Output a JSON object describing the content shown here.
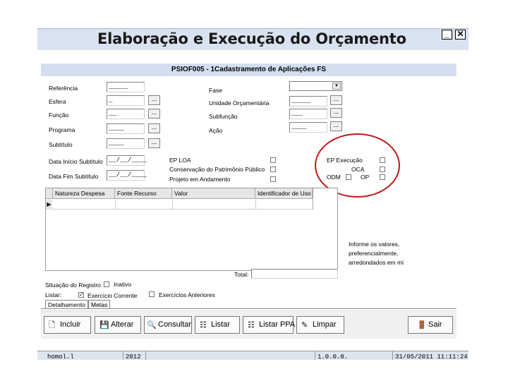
{
  "window": {
    "title": "Elaboração e Execução do Orçamento",
    "minimize_label": "_",
    "close_label": "✕"
  },
  "form": {
    "header": "PSIOF005 - 1Cadastramento de Aplicações FS",
    "left": {
      "referencia": {
        "label": "Referência",
        "value": "_____"
      },
      "esfera": {
        "label": "Esfera",
        "value": "_",
        "button": "..."
      },
      "funcao": {
        "label": "Função",
        "value": "__",
        "button": "..."
      },
      "programa": {
        "label": "Programa",
        "value": "____",
        "button": "..."
      },
      "subtitulo": {
        "label": "Subtítulo",
        "value": "____",
        "button": "..."
      },
      "data_inicio": {
        "label": "Data Início Subtítulo",
        "value": "__/__/____"
      },
      "data_fim": {
        "label": "Data Fim Subtítulo",
        "value": "__/__/____"
      }
    },
    "right": {
      "fase": {
        "label": "Fase",
        "value": ""
      },
      "unidade": {
        "label": "Unidade Orçamentária",
        "value": "_____",
        "button": "..."
      },
      "subfuncao": {
        "label": "Subfunção",
        "value": "___",
        "button": "..."
      },
      "acao": {
        "label": "Ação",
        "value": "____",
        "button": "..."
      }
    },
    "checks_mid": [
      {
        "label": "EP LOA",
        "checked": false
      },
      {
        "label": "Conservação do Patrimônio Público",
        "checked": false
      },
      {
        "label": "Projeto em Andamento",
        "checked": false
      }
    ],
    "checks_highlight": {
      "ep_execucao": "EP Execução",
      "oca": "OCA",
      "odm": "ODM",
      "op": "OP"
    }
  },
  "grid": {
    "columns": [
      "Natureza Despesa",
      "Fonte Recurso",
      "Valor",
      "Identificador de Uso"
    ],
    "row_indicator": "▶",
    "total_label": "Total:",
    "total_value": ""
  },
  "info_text": [
    "Informe os valores,",
    "preferencialmente,",
    "arredondados em mi"
  ],
  "situacao": {
    "label": "Situação do Registro",
    "inativo": "Inativo"
  },
  "listar": {
    "label": "Listar:",
    "exercicio_corrente": "Exercício Corrente",
    "exercicios_anteriores": "Exercícios Anteriores"
  },
  "tabs": [
    "Detalhamento",
    "Metas"
  ],
  "toolbar": {
    "incluir": "Incluir",
    "alterar": "Alterar",
    "consultar": "Consultar",
    "listar": "Listar",
    "listar_ppa": "Listar PPA",
    "limpar": "Limpar",
    "sair": "Sair"
  },
  "statusbar": {
    "user": "homol.l",
    "year": "2012",
    "version": "1.0.0.0.",
    "datetime": "31/05/2011 11:11:24"
  },
  "colors": {
    "title_bar": "#d9e2f0",
    "subheader": "#d4def0",
    "highlight": "#c01818"
  }
}
